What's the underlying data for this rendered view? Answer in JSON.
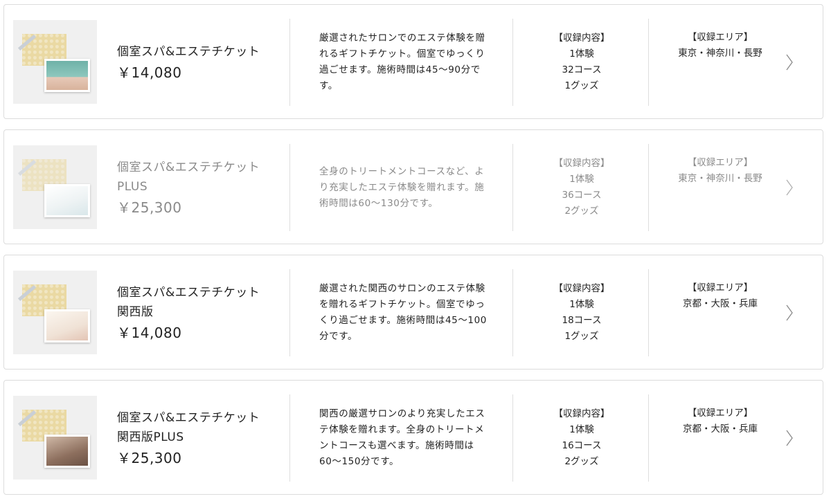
{
  "products": [
    {
      "name_line1": "個室スパ&エステチケット",
      "name_line2": "",
      "price": "￥14,080",
      "description": "厳選されたサロンでのエステ体験を贈れるギフトチケット。個室でゆっくり過ごせます。施術時間は45〜90分です。",
      "contents_heading": "【収録内容】",
      "contents": [
        "1体験",
        "32コース",
        "1グッズ"
      ],
      "area_heading": "【収録エリア】",
      "area": "東京・神奈川・長野",
      "thumb_photo": "p0",
      "faded": false
    },
    {
      "name_line1": "個室スパ&エステチケット",
      "name_line2": "PLUS",
      "price": "￥25,300",
      "description": "全身のトリートメントコースなど、より充実したエステ体験を贈れます。施術時間は60〜130分です。",
      "contents_heading": "【収録内容】",
      "contents": [
        "1体験",
        "36コース",
        "2グッズ"
      ],
      "area_heading": "【収録エリア】",
      "area": "東京・神奈川・長野",
      "thumb_photo": "p1",
      "faded": true
    },
    {
      "name_line1": "個室スパ&エステチケット",
      "name_line2": "関西版",
      "price": "￥14,080",
      "description": "厳選された関西のサロンのエステ体験を贈れるギフトチケット。個室でゆっくり過ごせます。施術時間は45〜100分です。",
      "contents_heading": "【収録内容】",
      "contents": [
        "1体験",
        "18コース",
        "1グッズ"
      ],
      "area_heading": "【収録エリア】",
      "area": "京都・大阪・兵庫",
      "thumb_photo": "p2",
      "faded": false
    },
    {
      "name_line1": "個室スパ&エステチケット",
      "name_line2": "関西版PLUS",
      "price": "￥25,300",
      "description": "関西の厳選サロンのより充実したエステ体験を贈れます。全身のトリートメントコースも選べます。施術時間は60〜150分です。",
      "contents_heading": "【収録内容】",
      "contents": [
        "1体験",
        "16コース",
        "2グッズ"
      ],
      "area_heading": "【収録エリア】",
      "area": "京都・大阪・兵庫",
      "thumb_photo": "p3",
      "faded": false
    }
  ],
  "icons": {
    "chevron": "chevron-right-icon"
  },
  "colors": {
    "text": "#222222",
    "muted": "#8a8a8a",
    "border": "#dcdcdc"
  }
}
